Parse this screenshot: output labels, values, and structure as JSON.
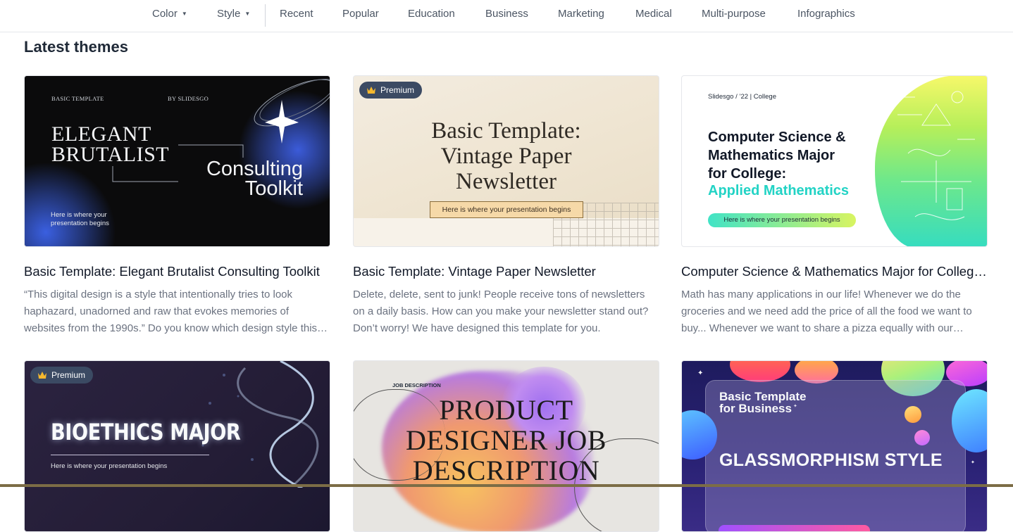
{
  "nav": {
    "items": [
      {
        "label": "Color",
        "dropdown": true
      },
      {
        "label": "Style",
        "dropdown": true
      },
      {
        "label": "Recent"
      },
      {
        "label": "Popular"
      },
      {
        "label": "Education"
      },
      {
        "label": "Business"
      },
      {
        "label": "Marketing"
      },
      {
        "label": "Medical"
      },
      {
        "label": "Multi-purpose"
      },
      {
        "label": "Infographics"
      }
    ]
  },
  "section": {
    "title": "Latest themes"
  },
  "premium_label": "Premium",
  "cards": [
    {
      "title": "Basic Template: Elegant Brutalist Consulting Toolkit",
      "desc": "“This digital design is a style that intentionally tries to look haphazard, unadorned and raw that evokes memories of websites from the 1990s.” Do you know which design style this is?",
      "thumb": {
        "top_left": "BASIC TEMPLATE",
        "top_right": "BY SLIDESGO",
        "big": "ELEGANT\nBRUTALIST",
        "right": "Consulting\nToolkit",
        "foot": "Here is where your\npresentation begins"
      }
    },
    {
      "title": "Basic Template: Vintage Paper Newsletter",
      "desc": "Delete, delete, sent to junk! People receive tons of newsletters on a daily basis. How can you make your newsletter stand out? Don’t worry! We have designed this template for you.",
      "premium": true,
      "thumb": {
        "title": "Basic Template:\nVintage Paper\nNewsletter",
        "pill": "Here is where your presentation begins"
      }
    },
    {
      "title": "Computer Science & Mathematics Major for College: Applied Mathematics",
      "desc": "Math has many applications in our life! Whenever we do the groceries and we need add the price of all the food we want to buy... Whenever we want to share a pizza equally with our friends...",
      "thumb": {
        "header": "Slidesgo / ’22  |  College",
        "title": "Computer Science &\nMathematics Major\nfor College:",
        "subtitle": "Applied Mathematics",
        "pill": "Here is where your presentation begins"
      }
    },
    {
      "premium": true,
      "thumb": {
        "title": "BIOETHICS MAJOR",
        "sub": "Here is where your presentation begins"
      }
    },
    {
      "thumb": {
        "label": "JOB DESCRIPTION",
        "title": "PRODUCT\nDESIGNER JOB\nDESCRIPTION"
      }
    },
    {
      "thumb": {
        "small": "Basic Template\nfor Business",
        "big": "GLASSMORPHISM STYLE"
      }
    }
  ]
}
